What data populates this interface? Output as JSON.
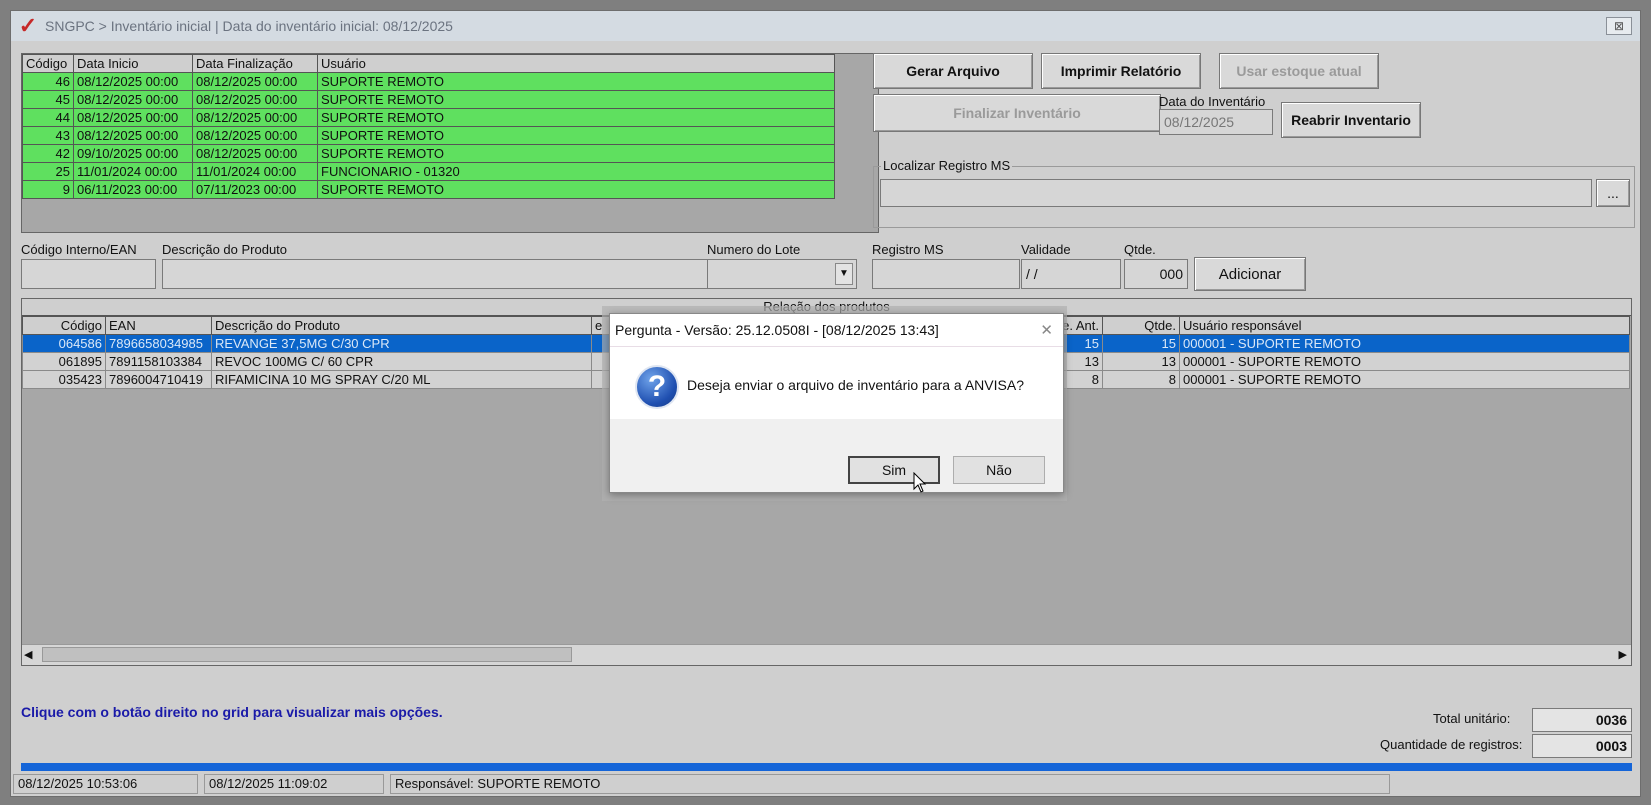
{
  "window": {
    "title": "SNGPC > Inventário inicial  |  Data do inventário inicial: 08/12/2025",
    "close_glyph": "⊠"
  },
  "inventories": {
    "headers": [
      "Código",
      "Data Inicio",
      "Data Finalização",
      "Usuário"
    ],
    "rows": [
      [
        "46",
        "08/12/2025 00:00",
        "08/12/2025 00:00",
        "SUPORTE REMOTO"
      ],
      [
        "45",
        "08/12/2025 00:00",
        "08/12/2025 00:00",
        "SUPORTE REMOTO"
      ],
      [
        "44",
        "08/12/2025 00:00",
        "08/12/2025 00:00",
        "SUPORTE REMOTO"
      ],
      [
        "43",
        "08/12/2025 00:00",
        "08/12/2025 00:00",
        "SUPORTE REMOTO"
      ],
      [
        "42",
        "09/10/2025 00:00",
        "08/12/2025 00:00",
        "SUPORTE REMOTO"
      ],
      [
        "25",
        "11/01/2024 00:00",
        "11/01/2024 00:00",
        "FUNCIONARIO - 01320"
      ],
      [
        "9",
        "06/11/2023 00:00",
        "07/11/2023 00:00",
        "SUPORTE REMOTO"
      ]
    ]
  },
  "actions": {
    "gerar_arquivo": "Gerar Arquivo",
    "imprimir_relatorio": "Imprimir Relatório",
    "usar_estoque": "Usar estoque atual",
    "finalizar": "Finalizar Inventário",
    "reabrir": "Reabrir Inventario",
    "data_inventario_label": "Data do Inventário",
    "data_inventario_value": "08/12/2025"
  },
  "localizar": {
    "label": "Localizar Registro MS",
    "browse": "..."
  },
  "entry": {
    "codigo_label": "Código Interno/EAN",
    "descricao_label": "Descrição do Produto",
    "lote_label": "Numero do Lote",
    "registro_label": "Registro MS",
    "validade_label": "Validade",
    "validade_value": " / /",
    "qtde_label": "Qtde.",
    "qtde_value": "000",
    "add_button": "Adicionar"
  },
  "products": {
    "caption": "Relação dos produtos",
    "headers": [
      "Código",
      "EAN",
      "Descrição do Produto",
      "e",
      "Qtde. Ant.",
      "Qtde.",
      "Usuário responsável"
    ],
    "rows": [
      [
        "064586",
        "7896658034985",
        "REVANGE 37,5MG C/30 CPR",
        "",
        "15",
        "15",
        "000001 - SUPORTE REMOTO"
      ],
      [
        "061895",
        "7891158103384",
        "REVOC 100MG C/ 60 CPR",
        "",
        "13",
        "13",
        "000001 - SUPORTE REMOTO"
      ],
      [
        "035423",
        "7896004710419",
        "RIFAMICINA 10 MG SPRAY C/20 ML",
        "",
        "8",
        "8",
        "000001 - SUPORTE REMOTO"
      ]
    ]
  },
  "hint": "Clique com o botão direito no grid para visualizar mais opções.",
  "totals": {
    "total_label": "Total unitário:",
    "total_value": "0036",
    "qtd_label": "Quantidade de registros:",
    "qtd_value": "0003"
  },
  "status": {
    "start": "08/12/2025 10:53:06",
    "now": "08/12/2025 11:09:02",
    "responsavel": "Responsável: SUPORTE REMOTO"
  },
  "dialog": {
    "title": "Pergunta - Versão: 25.12.0508I - [08/12/2025 13:43]",
    "message": "Deseja enviar o arquivo de inventário para a ANVISA?",
    "yes": "Sim",
    "no": "Não",
    "close_glyph": "✕"
  },
  "colors": {
    "row_green": "#5fe05f",
    "selection_blue": "#0a64c9",
    "hint_blue": "#1a1aa8",
    "progress_blue": "#1565d8"
  }
}
